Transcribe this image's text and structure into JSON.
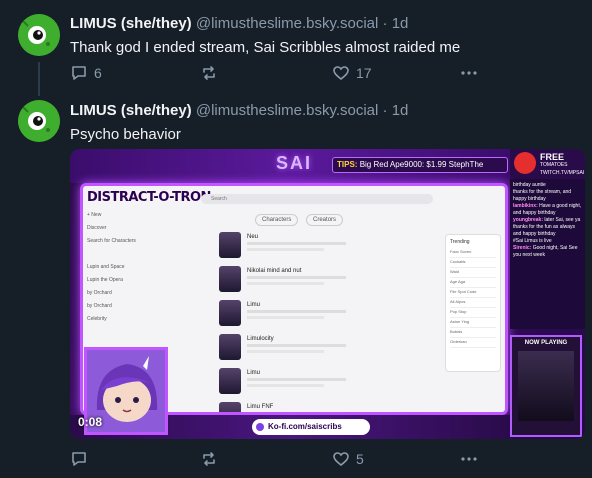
{
  "posts": [
    {
      "author_name": "LIMUS (she/they)",
      "handle": "@limustheslime.bsky.social",
      "separator": "·",
      "time": "1d",
      "text": "Thank god I ended stream, Sai Scribbles almost raided me",
      "reply_count": "6",
      "repost_count": "",
      "like_count": "17"
    },
    {
      "author_name": "LIMUS (she/they)",
      "handle": "@limustheslime.bsky.social",
      "separator": "·",
      "time": "1d",
      "text": "Psycho behavior",
      "reply_count": "",
      "repost_count": "",
      "like_count": "5",
      "video": {
        "timestamp": "0:08",
        "overlay_title": "SAI",
        "tips_label": "TIPS:",
        "tips_text": "Big Red Ape9000: $1.99  StephThe",
        "app_logo": "DISTRACT-O-TRON",
        "search_placeholder": "Search",
        "tabs": [
          "Characters",
          "Creators"
        ],
        "sidebar": [
          "+ New",
          "Discover",
          "Search for Characters",
          "",
          "Lupin and Space",
          "Lupin the Opera",
          "by Orchard",
          "by Orchard",
          "Celebrity"
        ],
        "characters": [
          {
            "title": "Neu"
          },
          {
            "title": "Nikolai mind and nut"
          },
          {
            "title": "Limu"
          },
          {
            "title": "Limulocity"
          },
          {
            "title": "Limu"
          },
          {
            "title": "Limu FNF"
          }
        ],
        "trending_title": "Trending",
        "trending": [
          "Faux Soven",
          "Cockatts",
          "Wald",
          "Age Aga",
          "File Spot Code",
          "All Alpos",
          "Pop Stop",
          "Aston Ying",
          "Bobids",
          "Orderkan"
        ],
        "tomato_free": "FREE",
        "tomato_label": "TOMATOES",
        "tomato_url": "TWITCH.TV/MPSAI",
        "chat": [
          {
            "user": "",
            "msg": "birthday auntie"
          },
          {
            "user": "",
            "msg": "thanks for the stream, and happy birthday"
          },
          {
            "user": "lambikinx:",
            "msg": "Have a good night, and happy birthday"
          },
          {
            "user": "youngbreak:",
            "msg": "later Sai, see ya thanks for the fun as always and happy birthday"
          },
          {
            "user": "",
            "msg": "#Sai Limus is live"
          },
          {
            "user": "Sirenic:",
            "msg": "Good night, Sai See you next week"
          }
        ],
        "now_playing": "NOW PLAYING",
        "kofi": "Ko-fi.com/saiscribs"
      }
    }
  ],
  "colors": {
    "background": "#161e27",
    "text": "#f1f3f5",
    "muted": "#8a9aac",
    "avatar_green": "#37a02b"
  },
  "icons": [
    "reply-icon",
    "repost-icon",
    "like-icon",
    "more-icon"
  ]
}
